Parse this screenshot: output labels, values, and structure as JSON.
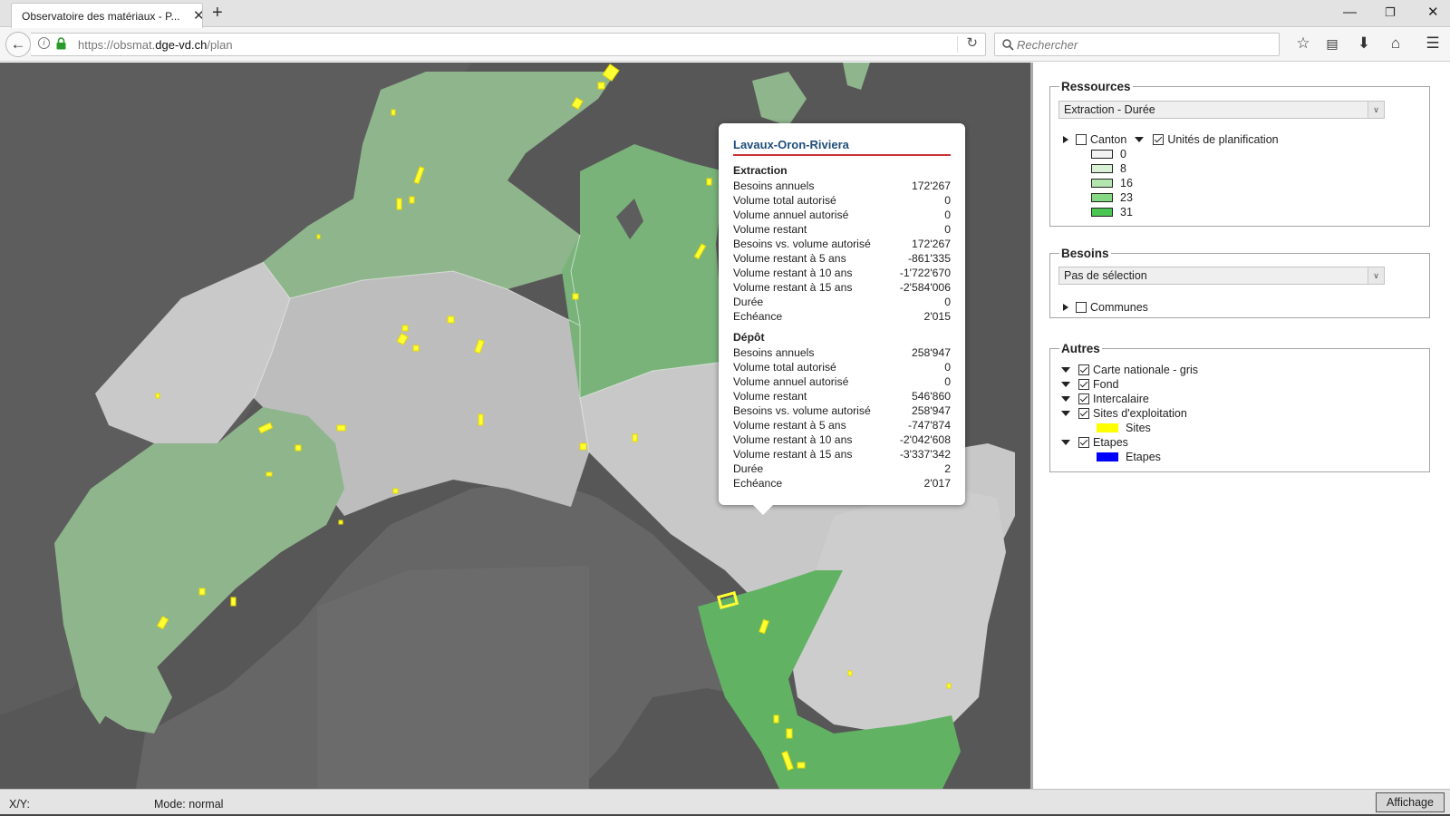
{
  "browser": {
    "tab_title": "Observatoire des matériaux - P...",
    "tab_close": "✕",
    "new_tab": "+",
    "url_scheme": "https://obsmat.",
    "url_host": "dge-vd.ch",
    "url_path": "/plan",
    "search_placeholder": "Rechercher"
  },
  "popup": {
    "title": "Lavaux-Oron-Riviera",
    "extraction": {
      "heading": "Extraction",
      "rows": [
        {
          "label": "Besoins annuels",
          "value": "172'267"
        },
        {
          "label": "Volume total autorisé",
          "value": "0"
        },
        {
          "label": "Volume annuel autorisé",
          "value": "0"
        },
        {
          "label": "Volume restant",
          "value": "0"
        },
        {
          "label": "Besoins vs. volume autorisé",
          "value": "172'267"
        },
        {
          "label": "Volume restant à 5 ans",
          "value": "-861'335"
        },
        {
          "label": "Volume restant à 10 ans",
          "value": "-1'722'670"
        },
        {
          "label": "Volume restant à 15 ans",
          "value": "-2'584'006"
        },
        {
          "label": "Durée",
          "value": "0"
        },
        {
          "label": "Echéance",
          "value": "2'015"
        }
      ]
    },
    "depot": {
      "heading": "Dépôt",
      "rows": [
        {
          "label": "Besoins annuels",
          "value": "258'947"
        },
        {
          "label": "Volume total autorisé",
          "value": "0"
        },
        {
          "label": "Volume annuel autorisé",
          "value": "0"
        },
        {
          "label": "Volume restant",
          "value": "546'860"
        },
        {
          "label": "Besoins vs. volume autorisé",
          "value": "258'947"
        },
        {
          "label": "Volume restant à 5 ans",
          "value": "-747'874"
        },
        {
          "label": "Volume restant à 10 ans",
          "value": "-2'042'608"
        },
        {
          "label": "Volume restant à 15 ans",
          "value": "-3'337'342"
        },
        {
          "label": "Durée",
          "value": "2"
        },
        {
          "label": "Echéance",
          "value": "2'017"
        }
      ]
    }
  },
  "panel": {
    "ressources": {
      "legend": "Ressources",
      "select_value": "Extraction - Durée",
      "canton_label": "Canton",
      "unites_label": "Unités de planification",
      "classes": [
        {
          "label": "0",
          "color": "#f2f2f2"
        },
        {
          "label": "8",
          "color": "#d8f0d4"
        },
        {
          "label": "16",
          "color": "#b3e6ae"
        },
        {
          "label": "23",
          "color": "#86d983"
        },
        {
          "label": "31",
          "color": "#4cc653"
        }
      ]
    },
    "besoins": {
      "legend": "Besoins",
      "select_value": "Pas de sélection",
      "communes_label": "Communes"
    },
    "autres": {
      "legend": "Autres",
      "carte_label": "Carte nationale - gris",
      "fond_label": "Fond",
      "intercalaire_label": "Intercalaire",
      "sites_label": "Sites d'exploitation",
      "sites_legend": "Sites",
      "sites_color": "#ffff00",
      "etapes_label": "Etapes",
      "etapes_legend": "Etapes",
      "etapes_color": "#0000ff"
    }
  },
  "status": {
    "xy": "X/Y:",
    "mode": "Mode: normal",
    "affichage": "Affichage"
  }
}
